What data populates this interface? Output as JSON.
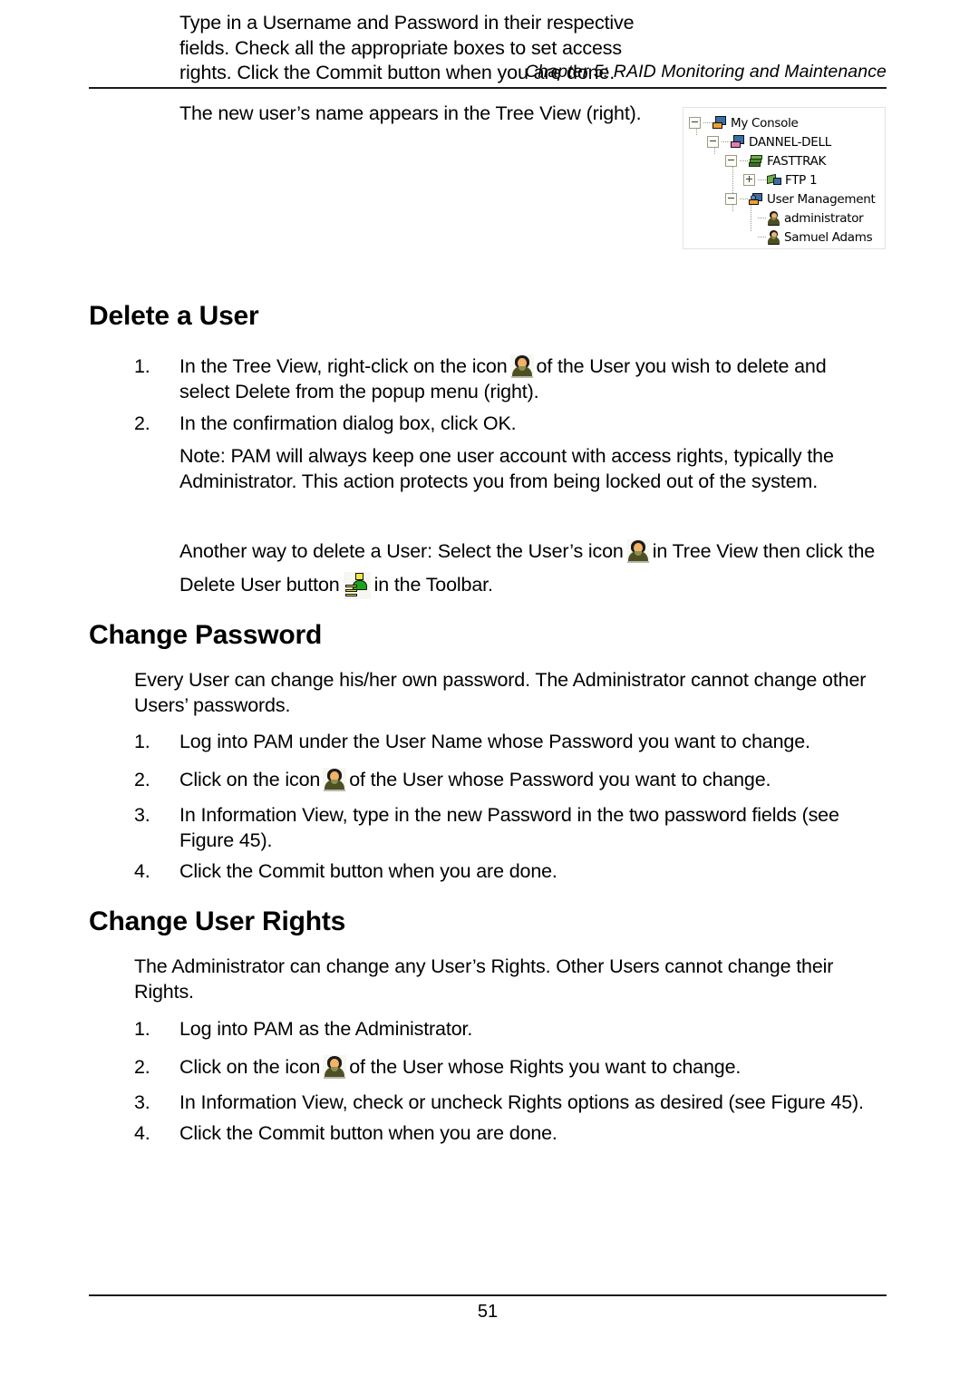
{
  "page": {
    "header": "Chapter 5: RAID Monitoring and Maintenance",
    "number": "51"
  },
  "intro": {
    "paragraph1": "Type in a Username and Password in their respective fields. Check all the appropriate boxes to set access rights. Click the Commit button when you are done.",
    "paragraph2": "The new user’s name appears in the Tree View (right)."
  },
  "tree_figure": {
    "nodes": [
      {
        "label": "My Console",
        "icon": "console-icon",
        "expander": "minus",
        "depth": 0
      },
      {
        "label": "DANNEL-DELL",
        "icon": "computer-icon",
        "expander": "minus",
        "depth": 1
      },
      {
        "label": "FASTTRAK",
        "icon": "raid-array-icon",
        "expander": "minus",
        "depth": 2
      },
      {
        "label": "FTP 1",
        "icon": "ftp-icon",
        "expander": "plus",
        "depth": 3
      },
      {
        "label": "User Management",
        "icon": "user-management-icon",
        "expander": "minus",
        "depth": 2
      },
      {
        "label": "administrator",
        "icon": "user-icon",
        "expander": "none",
        "depth": 3
      },
      {
        "label": "Samuel Adams",
        "icon": "user-icon",
        "expander": "none",
        "depth": 3
      }
    ]
  },
  "delete_user": {
    "heading": "Delete a User",
    "steps": [
      {
        "num": "1.",
        "text_before": "In the Tree View, right-click on the icon",
        "icon": "user-icon",
        "text_after": "of the User you wish to delete and select Delete from the popup menu (right)."
      },
      {
        "num": "2.",
        "text_before": "In the confirmation dialog box, click OK.",
        "icon": "",
        "text_after": ""
      }
    ],
    "note": "Note: PAM will always keep one user account with access rights, typically the Administrator. This action protects you from being locked out of the system.",
    "alt_before": "Another way to delete a User: Select the User’s icon",
    "alt_icon": "user-icon",
    "alt_middle": "in Tree View then click the Delete User button",
    "alt_icon2": "delete-user-button-icon",
    "alt_after": "in the Toolbar."
  },
  "change_password": {
    "heading": "Change Password",
    "intro": "Every User can change his/her own password. The Administrator cannot change other Users’ passwords.",
    "steps": [
      {
        "num": "1.",
        "text_before": "Log into PAM under the User Name whose Password you want to change.",
        "icon": "",
        "text_after": ""
      },
      {
        "num": "2.",
        "text_before": "Click on the icon",
        "icon": "user-icon",
        "text_after": "of the User whose Password you want to change."
      },
      {
        "num": "3.",
        "text_before": "In Information View, type in the new Password in the two password fields (see Figure 45).",
        "icon": "",
        "text_after": ""
      },
      {
        "num": "4.",
        "text_before": "Click the Commit button when you are done.",
        "icon": "",
        "text_after": ""
      }
    ]
  },
  "change_user_rights": {
    "heading": "Change User Rights",
    "intro": "The Administrator can change any User’s Rights. Other Users cannot change their Rights.",
    "steps": [
      {
        "num": "1.",
        "text_before": "Log into PAM as the Administrator.",
        "icon": "",
        "text_after": ""
      },
      {
        "num": "2.",
        "text_before": "Click on the icon",
        "icon": "user-icon",
        "text_after": "of the User whose Rights you want to change."
      },
      {
        "num": "3.",
        "text_before": "In Information View, check or uncheck Rights options as desired (see Figure 45).",
        "icon": "",
        "text_after": ""
      },
      {
        "num": "4.",
        "text_before": "Click the Commit button when you are done.",
        "icon": "",
        "text_after": ""
      }
    ]
  }
}
